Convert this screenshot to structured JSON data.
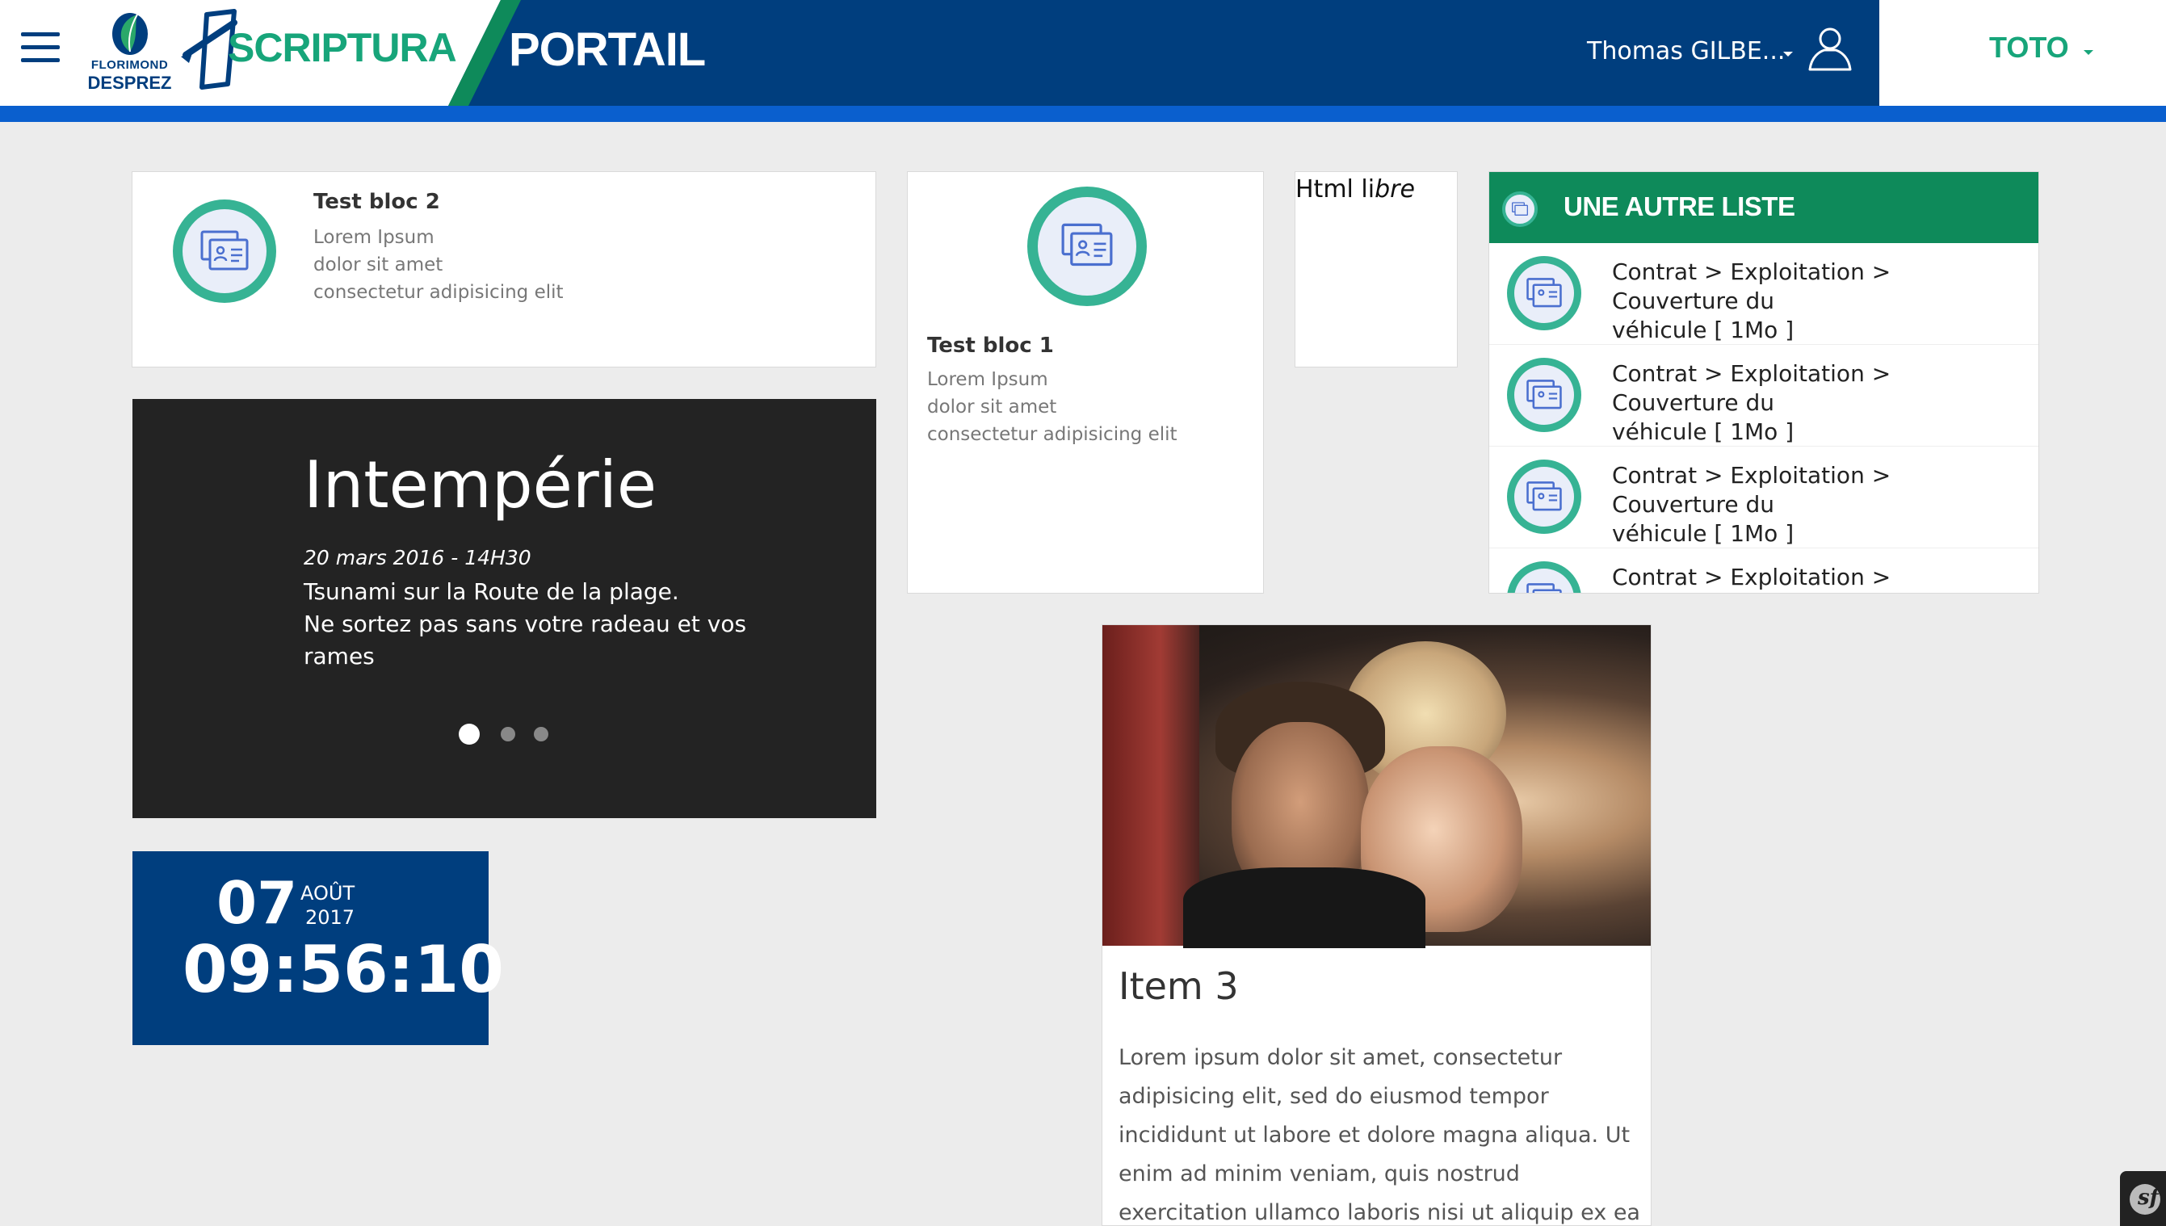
{
  "header": {
    "logo_fd_line1": "FLORIMOND",
    "logo_fd_line2": "DESPREZ",
    "logo_app": "SCRIPTURA",
    "section": "PORTAIL",
    "user_name": "Thomas GILBE...",
    "org_menu": "TOTO",
    "colors": {
      "primary": "#003e7e",
      "accent": "#0a5fce",
      "green": "#17a57a"
    }
  },
  "blocs": {
    "bloc2": {
      "title": "Test bloc 2",
      "lines": [
        "Lorem Ipsum",
        "dolor sit amet",
        "consectetur adipisicing elit"
      ],
      "icon": "id-card-icon"
    },
    "bloc1": {
      "title": "Test bloc 1",
      "lines": [
        "Lorem Ipsum",
        "dolor sit amet",
        "consectetur adipisicing elit"
      ],
      "icon": "id-card-icon"
    },
    "html_libre": {
      "normal": "Html li",
      "italic": "bre"
    }
  },
  "liste": {
    "title": "UNE AUTRE LISTE",
    "items": [
      {
        "line1": "Contrat > Exploitation > Couverture du",
        "line2": "véhicule [ 1Mo ]"
      },
      {
        "line1": "Contrat > Exploitation > Couverture du",
        "line2": "véhicule [ 1Mo ]"
      },
      {
        "line1": "Contrat > Exploitation > Couverture du",
        "line2": "véhicule [ 1Mo ]"
      },
      {
        "line1": "Contrat > Exploitation > Couverture du",
        "line2": ""
      }
    ]
  },
  "slider": {
    "title": "Intempérie",
    "date": "20 mars 2016 - 14H30",
    "lines": [
      "Tsunami sur la Route de la plage.",
      "Ne sortez pas sans votre radeau et vos",
      "rames"
    ],
    "dots": 3,
    "active_dot": 0
  },
  "clock": {
    "day": "07",
    "month": "AOÛT",
    "year": "2017",
    "time": "09:56:10"
  },
  "item3": {
    "title": "Item 3",
    "body": "Lorem ipsum dolor sit amet, consectetur adipisicing elit, sed do eiusmod tempor incididunt ut labore et dolore magna aliqua. Ut enim ad minim veniam, quis nostrud exercitation ullamco laboris nisi ut aliquip ex ea commodo consequat."
  },
  "debug_badge": {
    "icon": "symfony-icon",
    "glyph": "sf"
  }
}
